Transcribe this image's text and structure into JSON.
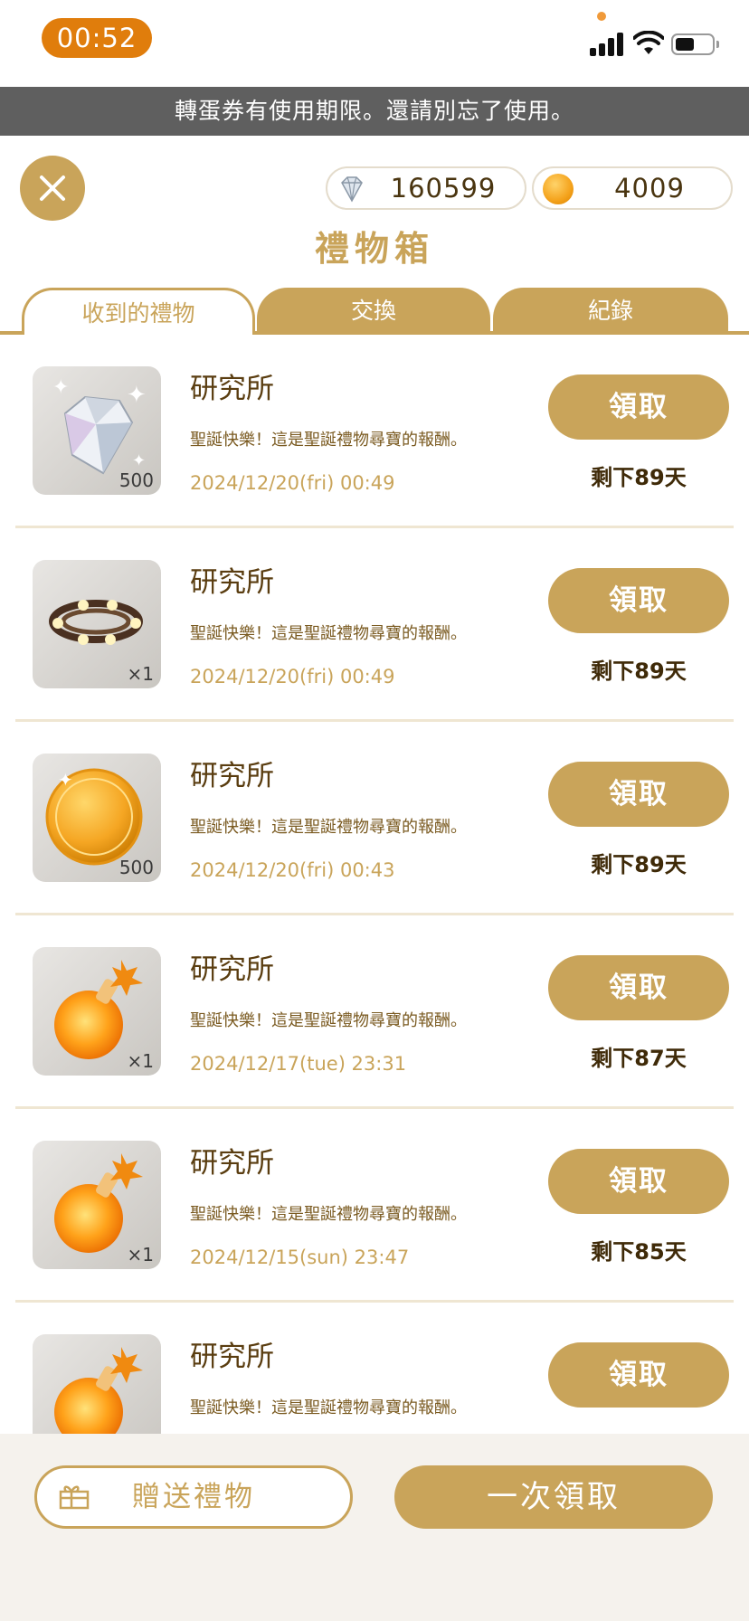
{
  "status_bar": {
    "time": "00:52"
  },
  "notice": "轉蛋券有使用期限。還請別忘了使用。",
  "currency": {
    "gems": "160599",
    "coins": "4009"
  },
  "title": "禮物箱",
  "tabs": [
    {
      "label": "收到的禮物",
      "active": true
    },
    {
      "label": "交換",
      "active": false
    },
    {
      "label": "紀錄",
      "active": false
    }
  ],
  "items": [
    {
      "icon": "diamond-icon",
      "quantity": "500",
      "sender": "研究所",
      "message": "聖誕快樂！這是聖誕禮物尋寶的報酬。",
      "date": "2024/12/20(fri) 00:49",
      "claim_label": "領取",
      "remaining": "剩下89天"
    },
    {
      "icon": "bead-bracelet-icon",
      "quantity": "×1",
      "sender": "研究所",
      "message": "聖誕快樂！這是聖誕禮物尋寶的報酬。",
      "date": "2024/12/20(fri) 00:49",
      "claim_label": "領取",
      "remaining": "剩下89天"
    },
    {
      "icon": "gold-coin-icon",
      "quantity": "500",
      "sender": "研究所",
      "message": "聖誕快樂！這是聖誕禮物尋寶的報酬。",
      "date": "2024/12/20(fri) 00:43",
      "claim_label": "領取",
      "remaining": "剩下89天"
    },
    {
      "icon": "orange-potion-icon",
      "quantity": "×1",
      "sender": "研究所",
      "message": "聖誕快樂！這是聖誕禮物尋寶的報酬。",
      "date": "2024/12/17(tue) 23:31",
      "claim_label": "領取",
      "remaining": "剩下87天"
    },
    {
      "icon": "orange-potion-icon",
      "quantity": "×1",
      "sender": "研究所",
      "message": "聖誕快樂！這是聖誕禮物尋寶的報酬。",
      "date": "2024/12/15(sun) 23:47",
      "claim_label": "領取",
      "remaining": "剩下85天"
    },
    {
      "icon": "orange-potion-icon",
      "quantity": "",
      "sender": "研究所",
      "message": "聖誕快樂！這是聖誕禮物尋寶的報酬。",
      "date": "",
      "claim_label": "領取",
      "remaining": ""
    }
  ],
  "bottom": {
    "send_label": "贈送禮物",
    "claim_all_label": "一次領取"
  },
  "colors": {
    "gold": "#c9a45a",
    "time_pill": "#e07d0c",
    "notice_bg": "#5f5f5f"
  }
}
